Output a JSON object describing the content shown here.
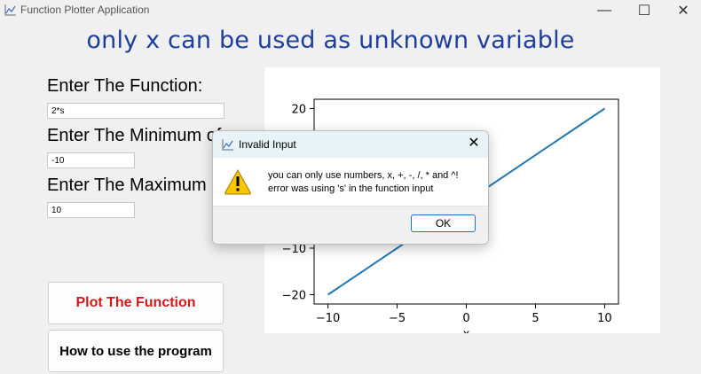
{
  "window": {
    "title": "Function Plotter Application",
    "controls": {
      "minimize": "—",
      "maximize": "☐",
      "close": "✕"
    }
  },
  "banner": "only x can be used as unknown variable",
  "form": {
    "function_label": "Enter The Function:",
    "function_value": "2*s",
    "minimum_label": "Enter The Minimum of",
    "minimum_value": "-10",
    "maximum_label": "Enter The Maximum",
    "maximum_value": "10",
    "plot_button": "Plot The Function",
    "help_button": "How to use the program"
  },
  "colors": {
    "plot_button_text": "#d11a1a",
    "line": "#1f77b4",
    "banner": "#1f3f9c"
  },
  "dialog": {
    "title": "Invalid Input",
    "message_line1": "you can only use numbers, x, +, -, /, * and ^!",
    "message_line2": "error was using 's' in the function input",
    "ok_label": "OK",
    "close_label": "✕",
    "icon": "warning-icon"
  },
  "chart_data": {
    "type": "line",
    "x": [
      -10,
      10
    ],
    "series": [
      {
        "values": [
          -20,
          20
        ]
      }
    ],
    "xlim": [
      -11,
      11
    ],
    "ylim": [
      -22,
      22
    ],
    "xticks": [
      "−10",
      "−5",
      "0",
      "5",
      "10"
    ],
    "yticks": [
      "20",
      "−10",
      "−20"
    ],
    "xlabel": "x"
  }
}
